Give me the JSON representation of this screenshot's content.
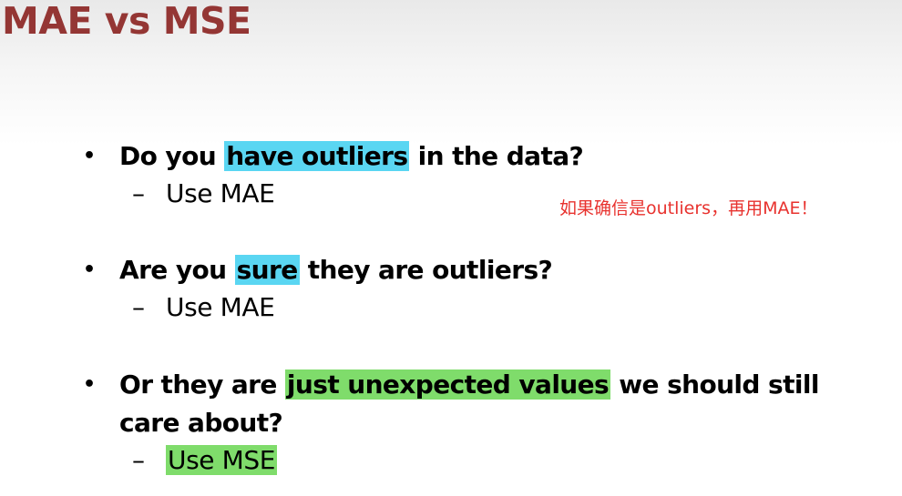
{
  "title": "MAE vs MSE",
  "bullets": [
    {
      "before": "Do you ",
      "highlight": "have outliers",
      "after": " in the data?",
      "sub": "Use MAE"
    },
    {
      "before": "Are you ",
      "highlight": "sure",
      "after": " they are outliers?",
      "sub": "Use MAE"
    },
    {
      "before": "Or they are ",
      "highlight": "just unexpected values",
      "after": " we should still",
      "line2": "care about?",
      "sub": "Use MSE"
    }
  ],
  "bullet_symbol": "•",
  "dash_symbol": "–",
  "annotation": "如果确信是outliers，再用MAE！",
  "colors": {
    "title": "#943634",
    "highlight_cyan": "#5ad6f2",
    "highlight_green": "#7fdc6b",
    "annotation": "#e8322e"
  }
}
